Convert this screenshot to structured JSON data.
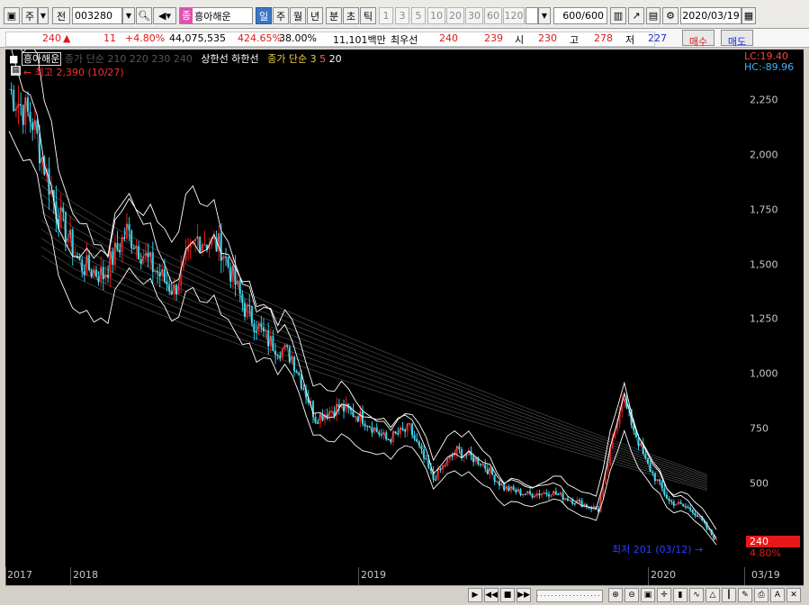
{
  "toolbar": {
    "mode_label": "주",
    "prev_label": "전",
    "code": "003280",
    "stock_badge": "종",
    "stock_name": "흥아해운",
    "periods": [
      {
        "label": "일",
        "active": true
      },
      {
        "label": "주",
        "active": false
      },
      {
        "label": "월",
        "active": false
      },
      {
        "label": "년",
        "active": false
      },
      {
        "label": "분",
        "active": false
      },
      {
        "label": "초",
        "active": false
      },
      {
        "label": "틱",
        "active": false
      }
    ],
    "intervals": [
      "1",
      "3",
      "5",
      "10",
      "20",
      "30",
      "60",
      "120"
    ],
    "count_value": "600",
    "count_total": "/600",
    "date": "2020/03/19"
  },
  "quote": {
    "price": "240",
    "arrow": "▲",
    "change": "11",
    "change_pct": "+4.80%",
    "volume": "44,075,535",
    "volume_ratio": "424.65%",
    "turnover": "38.00%",
    "amount": "11,101백만",
    "best_label": "최우선",
    "best_ask": "240",
    "best_bid": "239",
    "open_label": "시",
    "open": "230",
    "high_label": "고",
    "high": "278",
    "low_label": "저",
    "low": "227",
    "buy_label": "매수",
    "sell_label": "매도"
  },
  "legend": {
    "name": "흥아해운",
    "ma_label": "종가 단순",
    "ma_periods": "210  220  230  240",
    "limit_up": "상한선",
    "limit_down": "하한선",
    "ma2_label": "종가 단순",
    "ma2_p1": "3",
    "ma2_p2": "5",
    "ma2_p3": "20"
  },
  "annotations": {
    "high_text": "최고 2,390 (10/27)",
    "low_text": "최저 201 (03/12)",
    "lc": "LC:19.40",
    "hc": "HC:-89.96",
    "last_price": "240",
    "last_pct": "4.80%"
  },
  "axis": {
    "y_ticks": [
      "2,250",
      "2,000",
      "1,750",
      "1,500",
      "1,250",
      "1,000",
      "750",
      "500"
    ],
    "x_ticks": [
      "2017",
      "2018",
      "2019",
      "2020",
      "03/19"
    ]
  },
  "colors": {
    "up": "#e01818",
    "down": "#2ad0e8",
    "bg": "#000000",
    "band": "#ffffff",
    "ma": "#5a5a5a"
  },
  "chart_data": {
    "type": "line",
    "x": [
      "2017-09",
      "2017-10",
      "2017-11",
      "2017-12",
      "2018-01",
      "2018-02",
      "2018-03",
      "2018-04",
      "2018-05",
      "2018-06",
      "2018-07",
      "2018-08",
      "2018-09",
      "2018-10",
      "2018-11",
      "2018-12",
      "2019-01",
      "2019-02",
      "2019-03",
      "2019-04",
      "2019-05",
      "2019-06",
      "2019-07",
      "2019-08",
      "2019-09",
      "2019-10",
      "2019-11",
      "2019-12",
      "2020-01",
      "2020-02",
      "2020-03"
    ],
    "series": [
      {
        "values": [
          2300,
          2150,
          1750,
          1500,
          1450,
          1650,
          1500,
          1380,
          1620,
          1580,
          1300,
          1150,
          1080,
          800,
          850,
          800,
          700,
          750,
          520,
          650,
          600,
          480,
          450,
          460,
          420,
          380,
          900,
          600,
          420,
          380,
          240
        ]
      }
    ],
    "ylim": [
      200,
      2400
    ],
    "grid": false
  }
}
